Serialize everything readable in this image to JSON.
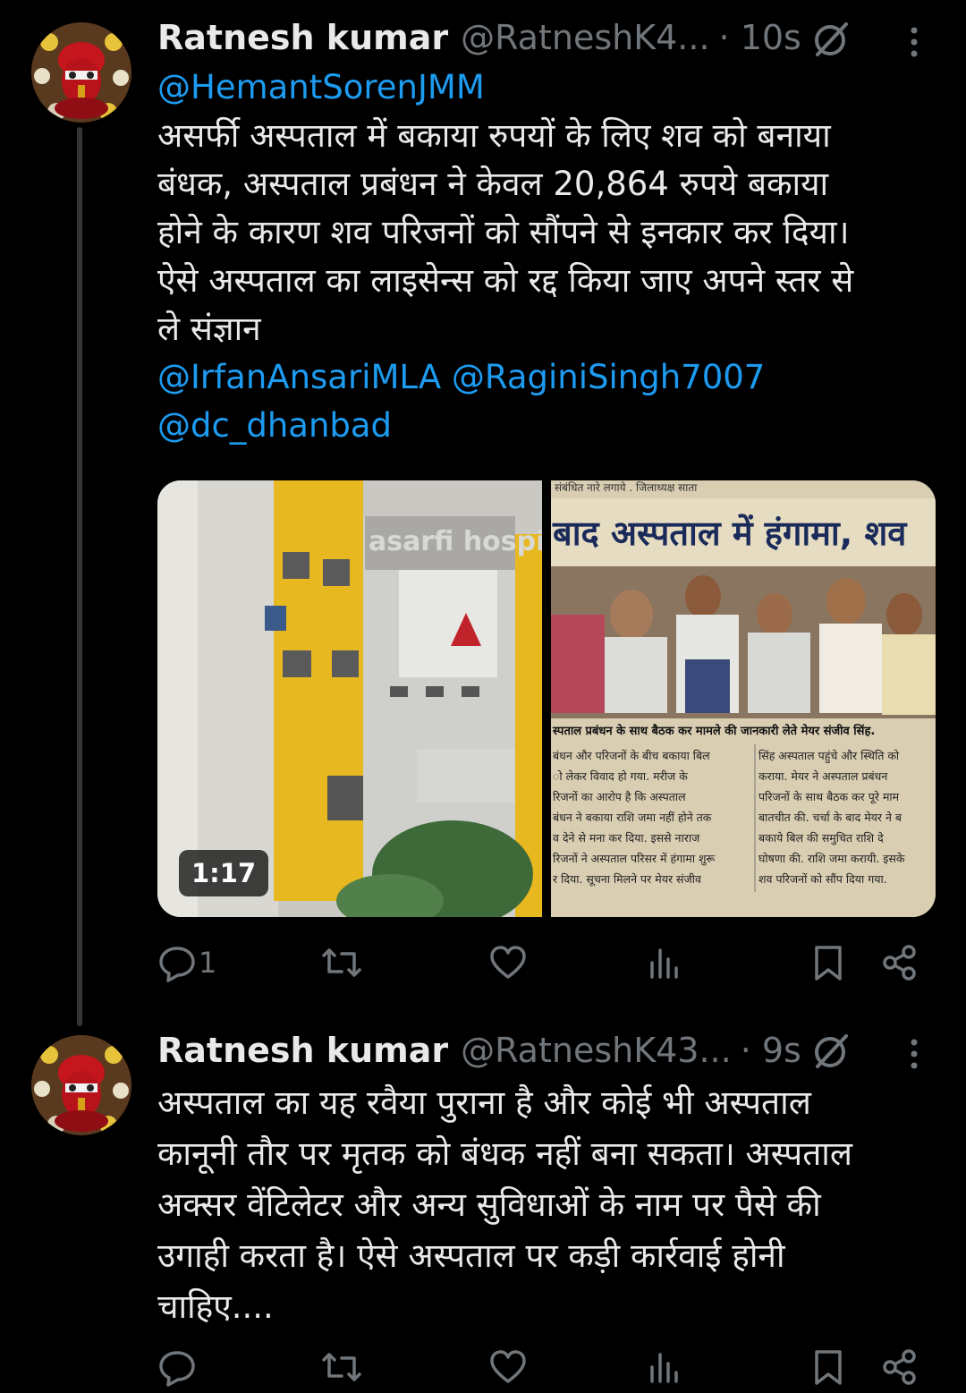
{
  "tweets": [
    {
      "author_name": "Ratnesh kumar",
      "author_handle": "@RatneshK4...",
      "time": "· 10s",
      "mention_top": "@HemantSorenJMM",
      "lines": [
        "असर्फी अस्पताल में बकाया रुपयों के लिए शव को बनाया",
        "बंधक, अस्पताल प्रबंधन ने केवल 20,864 रुपये बकाया",
        "होने के कारण शव परिजनों को सौंपने से इनकार कर दिया।",
        "ऐसे अस्पताल का लाइसेन्स को रद्द किया जाए अपने स्तर से",
        "ले संज्ञान"
      ],
      "mentions_bottom_1": "@IrfanAnsariMLA @RaginiSingh7007",
      "mentions_bottom_2": "@dc_dhanbad",
      "video_duration": "1:17",
      "video_sign": "asarfi hospital",
      "newspaper": {
        "top_strip": "संबंधित नारे लगाये . जिलाध्यक्ष साता",
        "headline": "बाद अस्पताल में हंगामा, शव",
        "caption": "स्पताल प्रबंधन के साथ बैठक कर मामले की जानकारी लेते मेयर संजीव सिंह.",
        "col1": [
          "बंधन और परिजनों के बीच बकाया बिल",
          "ो लेकर विवाद हो गया. मरीज के",
          "रिजनों का आरोप है कि अस्पताल",
          "बंधन ने बकाया राशि जमा नहीं होने तक",
          "व देने से मना कर दिया. इससे नाराज",
          "रिजनों ने अस्पताल परिसर में हंगामा शुरू",
          "र दिया. सूचना मिलने पर मेयर संजीव"
        ],
        "col2": [
          "सिंह अस्पताल पहुंचे और स्थिति को",
          "कराया. मेयर ने अस्पताल प्रबंधन",
          "परिजनों के साथ बैठक कर पूरे माम",
          "बातचीत की. चर्चा के बाद मेयर ने ब",
          "बकाये बिल की समुचित राशि दे",
          "घोषणा की. राशि जमा करायी. इसके",
          "शव परिजनों को सौंप दिया गया."
        ]
      },
      "reply_count": "1"
    },
    {
      "author_name": "Ratnesh kumar",
      "author_handle": "@RatneshK43...",
      "time": "· 9s",
      "lines": [
        "अस्पताल का यह रवैया पुराना है और कोई भी अस्पताल",
        "कानूनी तौर पर मृतक को बंधक नहीं बना सकता। अस्पताल",
        "अक्सर वेंटिलेटर और अन्य सुविधाओं के नाम पर पैसे की",
        "उगाही करता है। ऐसे अस्पताल पर कड़ी कार्रवाई होनी",
        "चाहिए...."
      ]
    }
  ],
  "colors": {
    "link": "#1d9bf0",
    "muted": "#71767b",
    "text": "#e7e9ea",
    "thread": "#333639"
  },
  "icons": [
    "reply-icon",
    "retweet-icon",
    "like-icon",
    "views-icon",
    "bookmark-icon",
    "share-icon",
    "edit-icon",
    "more-icon"
  ]
}
